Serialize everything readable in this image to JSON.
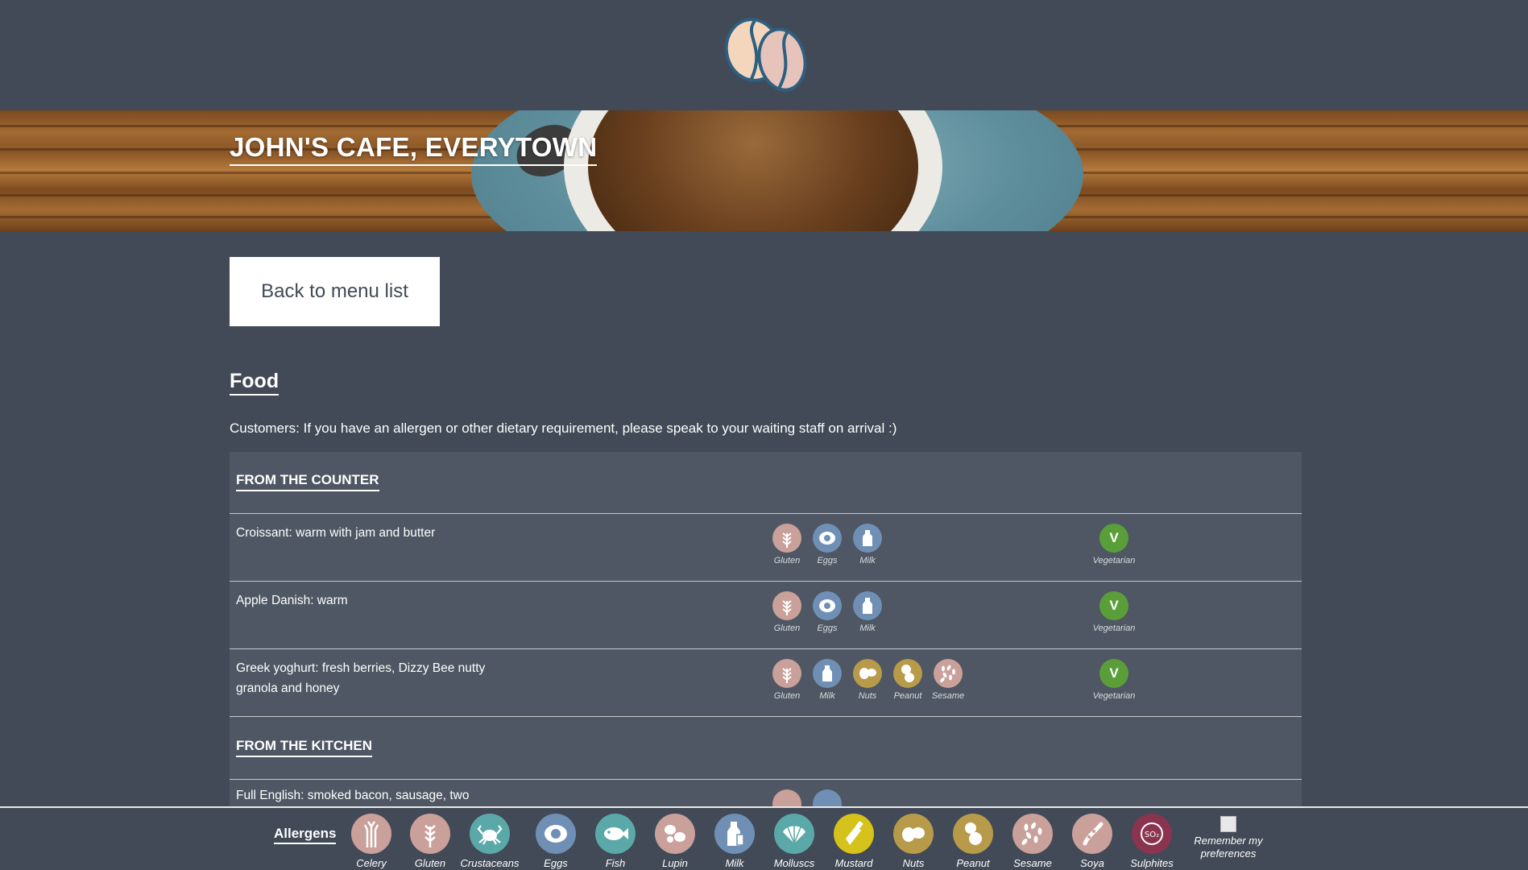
{
  "header": {
    "logo_icon": "coffee-beans-icon",
    "title": "JOHN'S CAFE, EVERYTOWN"
  },
  "nav": {
    "back_label": "Back to menu list"
  },
  "menu": {
    "section_title": "Food",
    "notice": "Customers: If you have an allergen or other dietary requirement, please speak to your waiting staff on arrival :)",
    "categories": [
      {
        "title": "FROM THE COUNTER",
        "items": [
          {
            "name": "Croissant: warm with jam and butter",
            "allergens": [
              "Gluten",
              "Eggs",
              "Milk"
            ],
            "diet": "Vegetarian",
            "diet_badge": "V"
          },
          {
            "name": "Apple Danish: warm",
            "allergens": [
              "Gluten",
              "Eggs",
              "Milk"
            ],
            "diet": "Vegetarian",
            "diet_badge": "V"
          },
          {
            "name": "Greek yoghurt: fresh berries, Dizzy Bee nutty granola and honey",
            "allergens": [
              "Gluten",
              "Milk",
              "Nuts",
              "Peanut",
              "Sesame"
            ],
            "diet": "Vegetarian",
            "diet_badge": "V"
          }
        ]
      },
      {
        "title": "FROM THE KITCHEN",
        "items": [
          {
            "name": "Full English: smoked bacon, sausage, two",
            "allergens": [
              "Gluten",
              "Eggs"
            ]
          }
        ]
      }
    ]
  },
  "allergen_colors": {
    "Celery": "#c9a09a",
    "Gluten": "#c9a09a",
    "Crustaceans": "#5aa9a8",
    "Eggs": "#6f8fb5",
    "Fish": "#5aa9a8",
    "Lupin": "#c9a09a",
    "Milk": "#6f8fb5",
    "Molluscs": "#5aa9a8",
    "Mustard": "#d5c21b",
    "Nuts": "#b79a4a",
    "Peanut": "#b79a4a",
    "Sesame": "#c9a09a",
    "Soya": "#c9a09a",
    "Sulphites": "#8a3450"
  },
  "footer": {
    "label": "Allergens",
    "allergens": [
      "Celery",
      "Gluten",
      "Crustaceans",
      "Eggs",
      "Fish",
      "Lupin",
      "Milk",
      "Molluscs",
      "Mustard",
      "Nuts",
      "Peanut",
      "Sesame",
      "Soya",
      "Sulphites"
    ],
    "sulphites_symbol": "SO₂",
    "remember_label": "Remember my preferences",
    "remember_checked": false
  }
}
